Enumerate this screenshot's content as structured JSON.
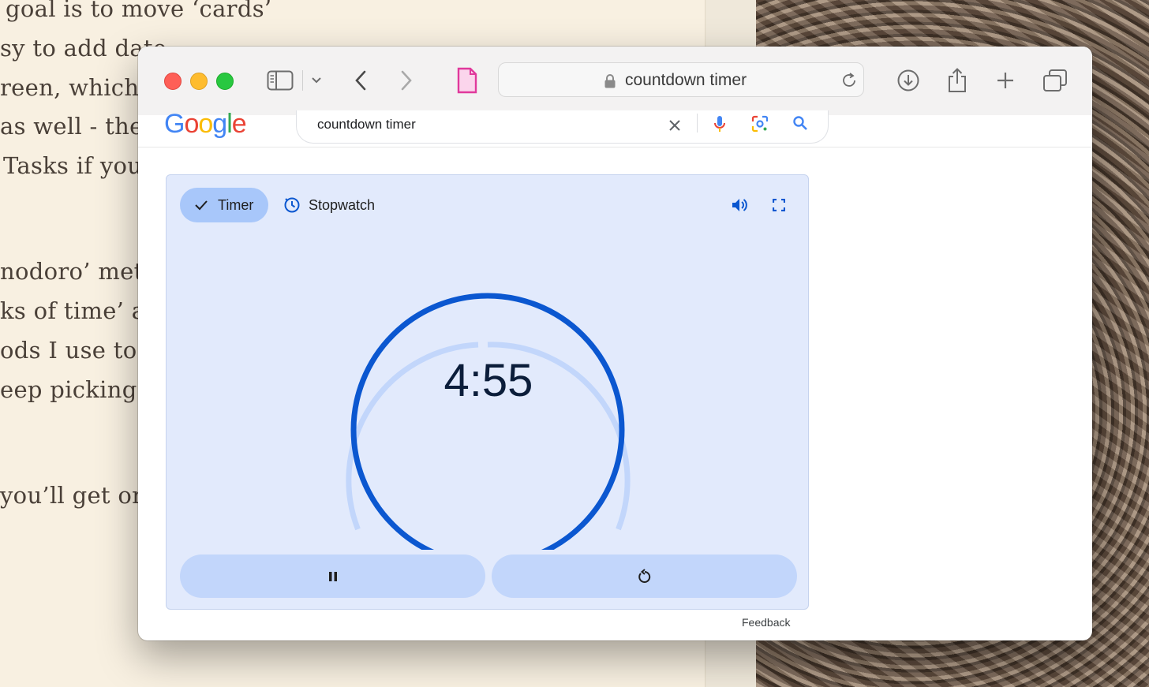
{
  "background_book": {
    "lines": [
      "goal is to move ‘cards’",
      "sy to add date",
      "reen, which i",
      "as well - ther",
      "Tasks if you",
      "nodoro’ meth",
      "ks of time’ an",
      "ods I use to d",
      "eep picking",
      "you’ll get on"
    ]
  },
  "browser": {
    "address_text": "countdown timer",
    "icons": [
      "sidebar-icon",
      "chevron-down-icon",
      "back-icon",
      "forward-icon",
      "tab-page-icon",
      "lock-icon",
      "reload-icon",
      "download-icon",
      "share-icon",
      "new-tab-icon",
      "tabs-overview-icon"
    ]
  },
  "google": {
    "logo": [
      "G",
      "o",
      "o",
      "g",
      "l",
      "e"
    ],
    "logo_colors": [
      "#4285F4",
      "#EA4335",
      "#FBBC05",
      "#4285F4",
      "#34A853",
      "#EA4335"
    ],
    "search_value": "countdown timer"
  },
  "timer": {
    "tab_timer": "Timer",
    "tab_stopwatch": "Stopwatch",
    "time_display": "4:55",
    "accent": "#0b57d0",
    "track_color": "#c2d6fb"
  },
  "footer": {
    "feedback": "Feedback"
  }
}
